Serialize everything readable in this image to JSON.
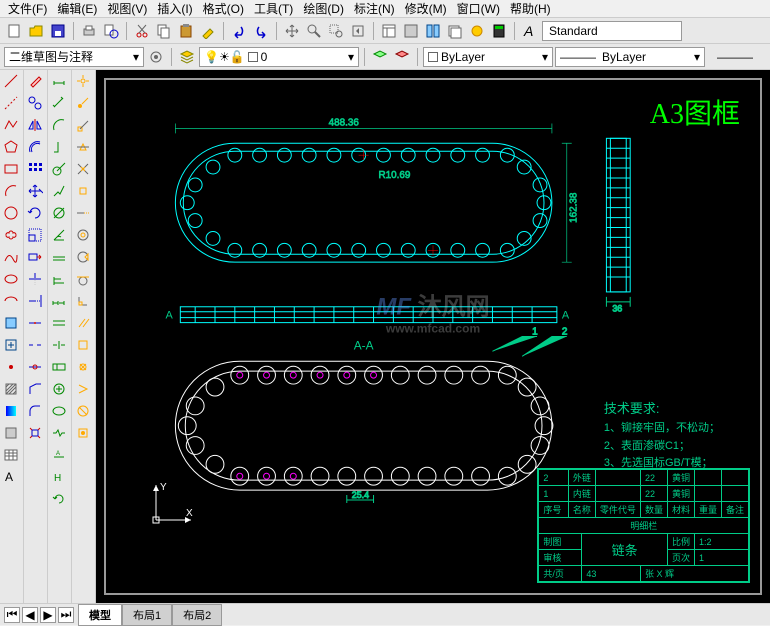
{
  "menu": {
    "file": "文件(F)",
    "edit": "编辑(E)",
    "view": "视图(V)",
    "insert": "插入(I)",
    "format": "格式(O)",
    "tools": "工具(T)",
    "draw": "绘图(D)",
    "dimension": "标注(N)",
    "modify": "修改(M)",
    "window": "窗口(W)",
    "help": "帮助(H)"
  },
  "toolbar": {
    "workspace_dropdown": "二维草图与注释",
    "layer_state": "0",
    "layer_bylayer": "ByLayer",
    "linetype_bylayer": "ByLayer",
    "style_standard": "Standard"
  },
  "drawing": {
    "frame_title": "A3图框",
    "dim_width": "488.36",
    "dim_height": "162.38",
    "dim_radius": "R10.69",
    "dim_side_width": "36",
    "dim_link": "25.4",
    "section_label_a": "A",
    "section_title": "A-A",
    "balloon_1": "1",
    "balloon_2": "2",
    "tech_req_title": "技术要求:",
    "tech_req_1": "1、铆接牢固，不松动；",
    "tech_req_2": "2、表面渗碳C1；",
    "tech_req_3": "3、先选国标GB/T模；"
  },
  "title_block": {
    "part_2": "外链",
    "part_2_qty": "22",
    "part_2_mat": "黄铜",
    "part_1": "内链",
    "part_1_qty": "22",
    "part_1_mat": "黄铜",
    "hdr_no": "序号",
    "hdr_name": "名称",
    "hdr_code": "零件代号",
    "hdr_qty": "数量",
    "hdr_mat": "材料",
    "hdr_wt": "重量",
    "hdr_note": "备注",
    "bom_title": "明细栏",
    "scale_label": "比例",
    "scale_val": "1:2",
    "sheet_label": "页次",
    "sheet_val": "1",
    "drawing_title": "链条",
    "qty_label": "共/页",
    "qty_val": "43",
    "drawer": "张 X 辉"
  },
  "watermark": {
    "main": "沐风网",
    "sub": "www.mfcad.com"
  },
  "tabs": {
    "model": "模型",
    "layout1": "布局1",
    "layout2": "布局2"
  },
  "ucs": {
    "x": "X",
    "y": "Y"
  }
}
